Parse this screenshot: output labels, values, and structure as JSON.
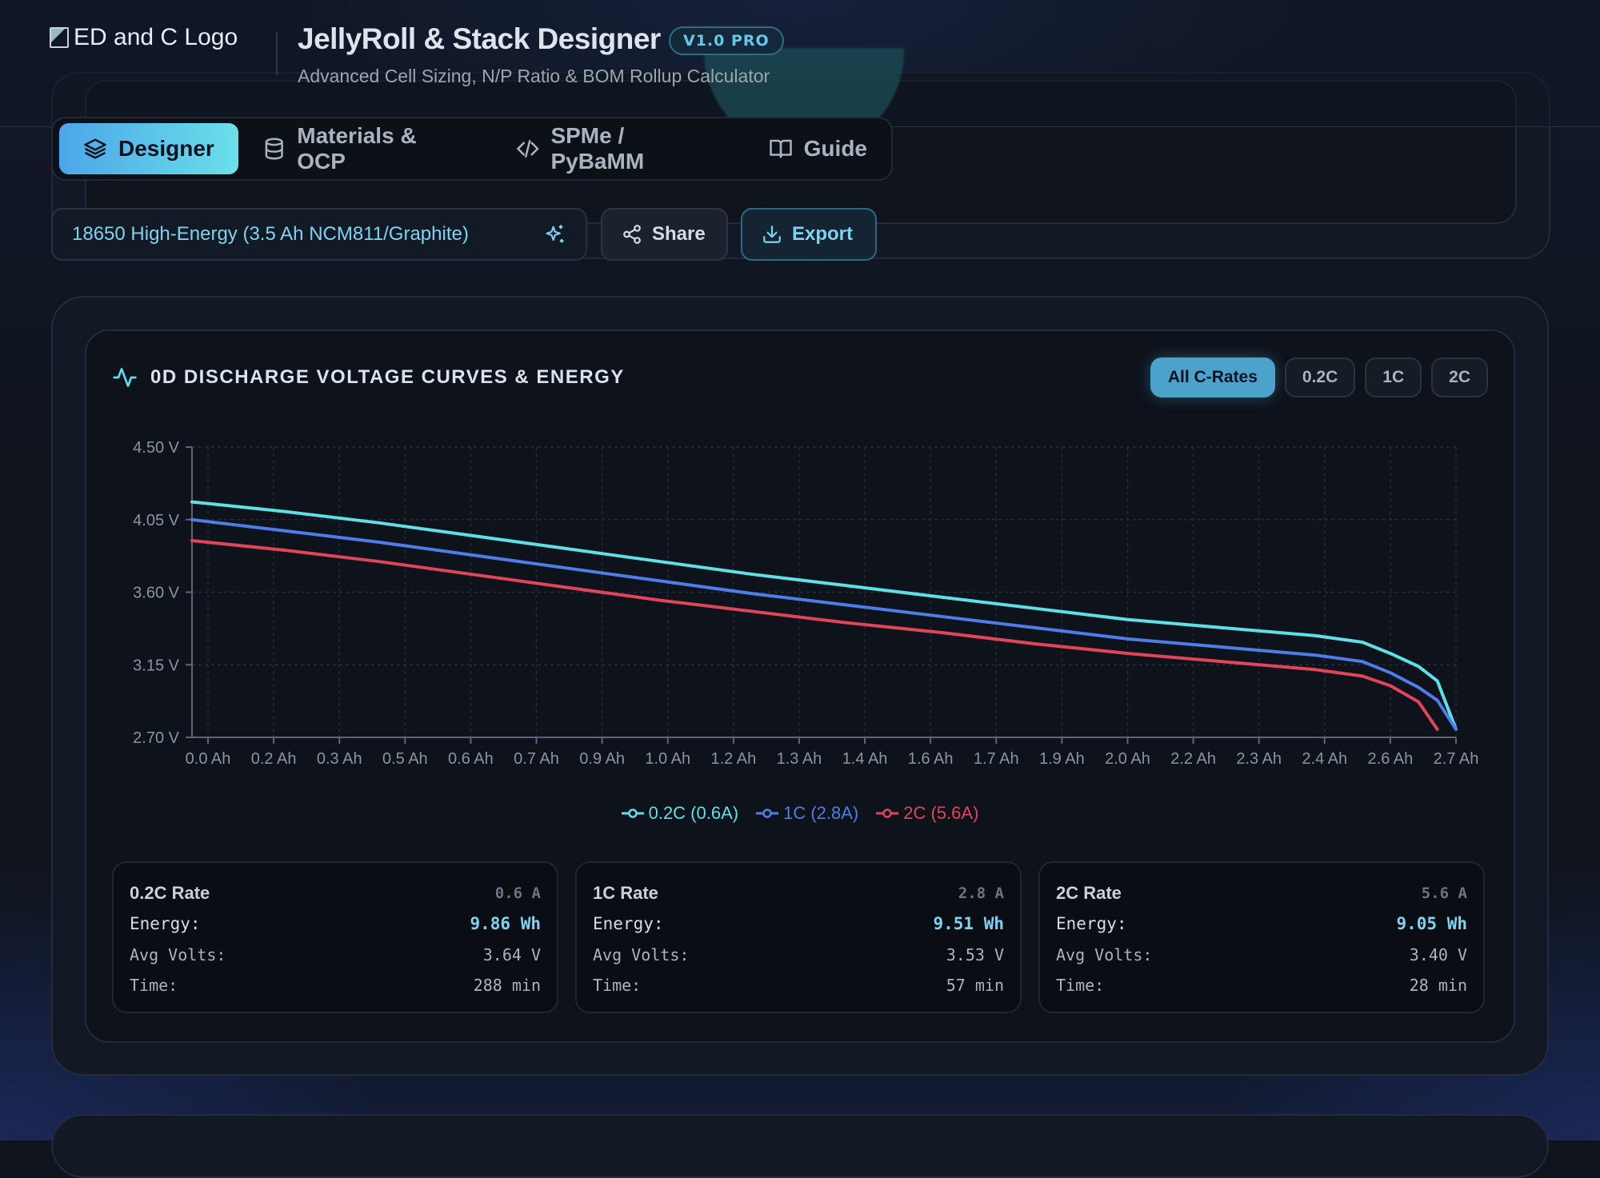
{
  "header": {
    "logo_alt": "ED and C Logo",
    "title": "JellyRoll & Stack Designer",
    "version": "V1.0 PRO",
    "subtitle": "Advanced Cell Sizing, N/P Ratio & BOM Rollup Calculator"
  },
  "tabs": [
    {
      "label": "Designer",
      "icon": "layers-icon",
      "active": true
    },
    {
      "label": "Materials & OCP",
      "icon": "database-icon",
      "active": false
    },
    {
      "label": "SPMe / PyBaMM",
      "icon": "code-icon",
      "active": false
    },
    {
      "label": "Guide",
      "icon": "book-icon",
      "active": false
    }
  ],
  "toolbar": {
    "preset": "18650 High-Energy (3.5 Ah NCM811/Graphite)",
    "share_label": "Share",
    "export_label": "Export"
  },
  "panel": {
    "title": "0D DISCHARGE VOLTAGE CURVES & ENERGY",
    "rate_filters": [
      {
        "label": "All C-Rates",
        "active": true
      },
      {
        "label": "0.2C",
        "active": false
      },
      {
        "label": "1C",
        "active": false
      },
      {
        "label": "2C",
        "active": false
      }
    ]
  },
  "chart_data": {
    "type": "line",
    "title": "",
    "xlabel": "",
    "ylabel": "",
    "x_ticks": [
      "0.0 Ah",
      "0.2 Ah",
      "0.3 Ah",
      "0.5 Ah",
      "0.6 Ah",
      "0.7 Ah",
      "0.9 Ah",
      "1.0 Ah",
      "1.2 Ah",
      "1.3 Ah",
      "1.4 Ah",
      "1.6 Ah",
      "1.7 Ah",
      "1.9 Ah",
      "2.0 Ah",
      "2.2 Ah",
      "2.3 Ah",
      "2.4 Ah",
      "2.6 Ah",
      "2.7 Ah"
    ],
    "y_ticks": [
      "4.50 V",
      "4.05 V",
      "3.60 V",
      "3.15 V",
      "2.70 V"
    ],
    "ylim": [
      2.7,
      4.5
    ],
    "xlim": [
      0.0,
      2.7
    ],
    "grid": true,
    "legend_position": "bottom-center",
    "series": [
      {
        "name": "0.2C (0.6A)",
        "color": "#5ee0e6",
        "x": [
          0.0,
          0.2,
          0.4,
          0.6,
          0.8,
          1.0,
          1.2,
          1.4,
          1.6,
          1.8,
          2.0,
          2.2,
          2.4,
          2.5,
          2.56,
          2.62,
          2.66,
          2.7
        ],
        "y": [
          4.16,
          4.1,
          4.03,
          3.95,
          3.87,
          3.79,
          3.71,
          3.64,
          3.57,
          3.5,
          3.43,
          3.38,
          3.33,
          3.29,
          3.22,
          3.14,
          3.05,
          2.75
        ]
      },
      {
        "name": "1C (2.8A)",
        "color": "#4f7de8",
        "x": [
          0.0,
          0.2,
          0.4,
          0.6,
          0.8,
          1.0,
          1.2,
          1.4,
          1.6,
          1.8,
          2.0,
          2.2,
          2.4,
          2.5,
          2.56,
          2.62,
          2.66,
          2.7
        ],
        "y": [
          4.05,
          3.98,
          3.91,
          3.83,
          3.75,
          3.67,
          3.59,
          3.52,
          3.45,
          3.38,
          3.31,
          3.26,
          3.21,
          3.17,
          3.1,
          3.01,
          2.93,
          2.75
        ]
      },
      {
        "name": "2C (5.6A)",
        "color": "#e0455a",
        "x": [
          0.0,
          0.2,
          0.4,
          0.6,
          0.8,
          1.0,
          1.2,
          1.4,
          1.6,
          1.8,
          2.0,
          2.2,
          2.4,
          2.5,
          2.56,
          2.62,
          2.66
        ],
        "y": [
          3.92,
          3.86,
          3.79,
          3.71,
          3.63,
          3.55,
          3.48,
          3.41,
          3.35,
          3.28,
          3.22,
          3.17,
          3.12,
          3.08,
          3.02,
          2.92,
          2.75
        ]
      }
    ]
  },
  "stats": [
    {
      "rate": "0.2C Rate",
      "amps": "0.6 A",
      "energy_label": "Energy:",
      "energy": "9.86 Wh",
      "avg_label": "Avg Volts:",
      "avg": "3.64 V",
      "time_label": "Time:",
      "time": "288 min"
    },
    {
      "rate": "1C Rate",
      "amps": "2.8 A",
      "energy_label": "Energy:",
      "energy": "9.51 Wh",
      "avg_label": "Avg Volts:",
      "avg": "3.53 V",
      "time_label": "Time:",
      "time": "57 min"
    },
    {
      "rate": "2C Rate",
      "amps": "5.6 A",
      "energy_label": "Energy:",
      "energy": "9.05 Wh",
      "avg_label": "Avg Volts:",
      "avg": "3.40 V",
      "time_label": "Time:",
      "time": "28 min"
    }
  ]
}
